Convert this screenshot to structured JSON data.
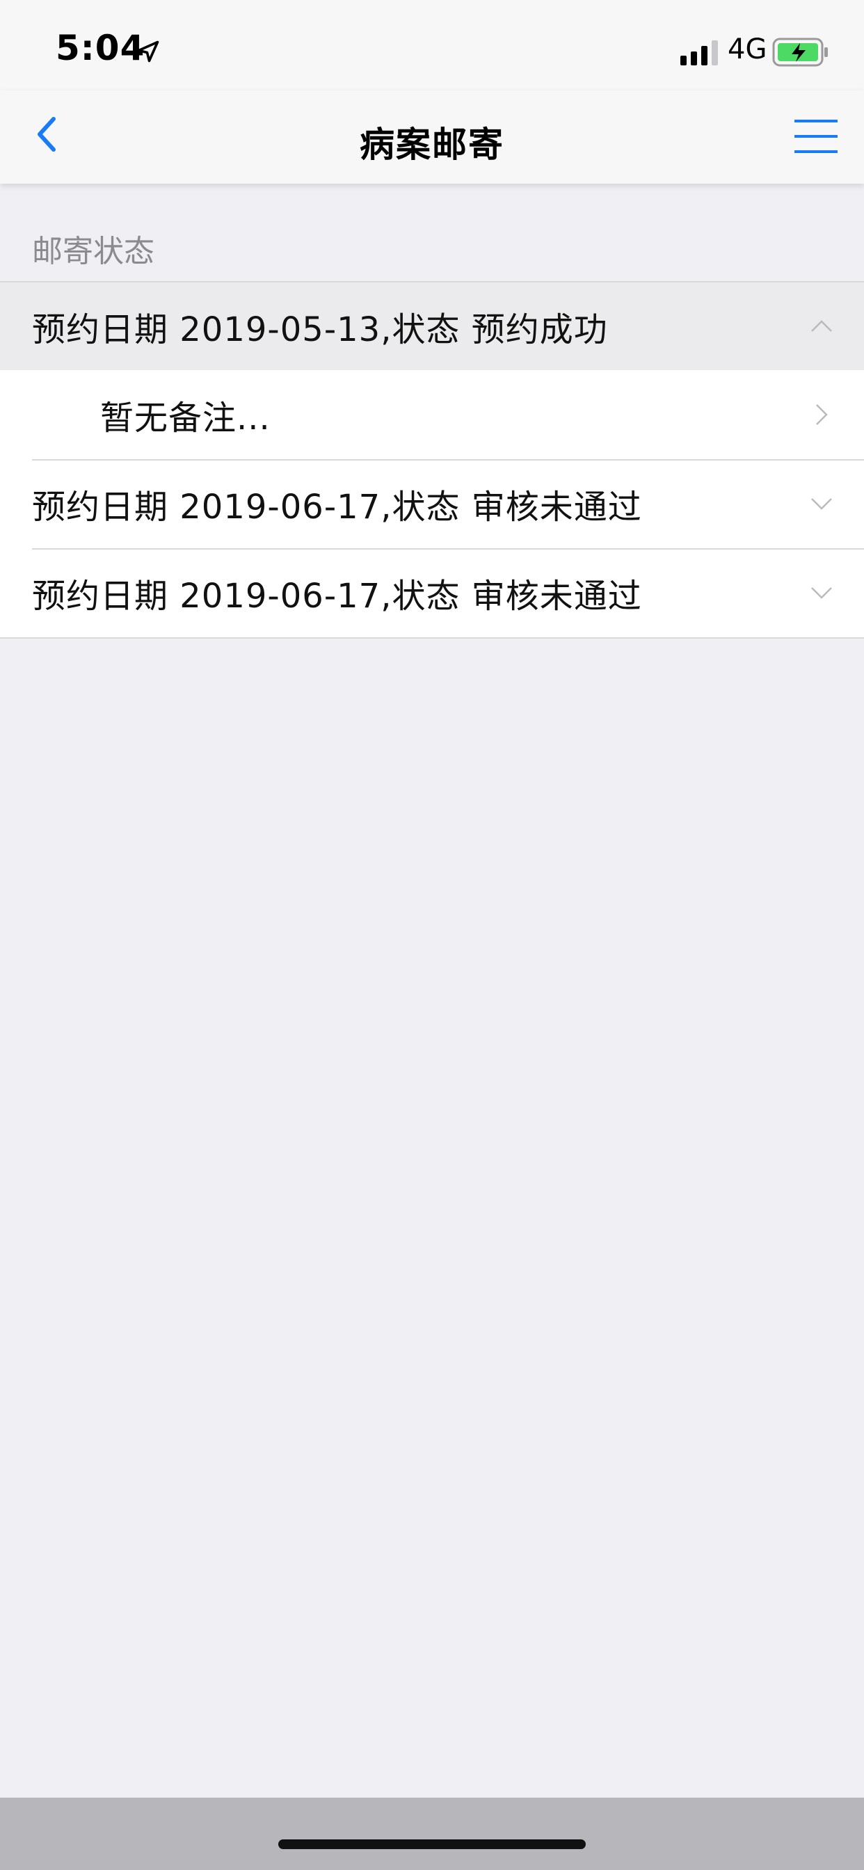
{
  "status_bar": {
    "time": "5:04",
    "network": "4G",
    "icons": [
      "location-arrow-icon",
      "signal-icon",
      "battery-charging-icon"
    ]
  },
  "nav": {
    "title": "病案邮寄",
    "back_icon": "chevron-left-icon",
    "menu_icon": "hamburger-menu-icon",
    "accent_color": "#1a7cf5"
  },
  "section": {
    "header": "邮寄状态"
  },
  "records": [
    {
      "label": "预约日期 2019-05-13,状态 预约成功",
      "expanded": true,
      "note": "暂无备注..."
    },
    {
      "label": "预约日期 2019-06-17,状态 审核未通过",
      "expanded": false
    },
    {
      "label": "预约日期 2019-06-17,状态 审核未通过",
      "expanded": false
    }
  ]
}
